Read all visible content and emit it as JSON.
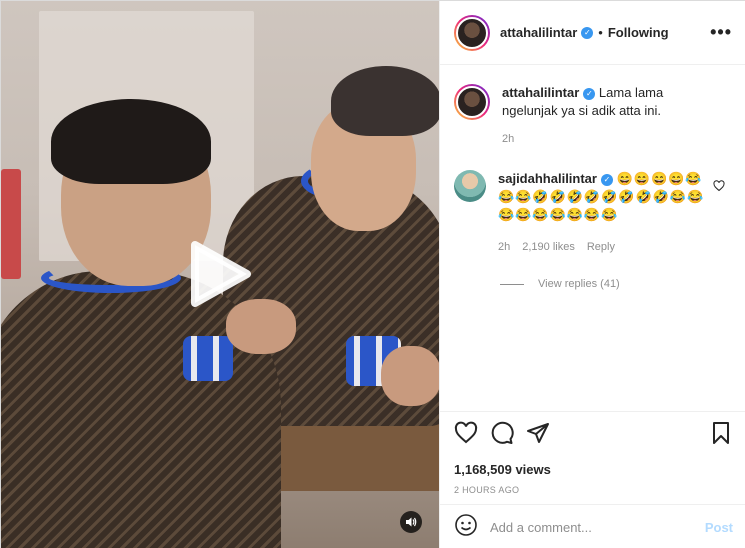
{
  "header": {
    "username": "attahalilintar",
    "separator": "•",
    "follow_status": "Following",
    "more_label": "•••"
  },
  "caption": {
    "username": "attahalilintar",
    "text": "Lama lama ngelunjak ya si adik atta ini.",
    "time": "2h"
  },
  "comment": {
    "username": "sajidahhalilintar",
    "text": "😄😄😄😄😂😂😂🤣🤣🤣🤣🤣🤣🤣🤣😂😂😂😂😂😂😂😂😂",
    "time": "2h",
    "likes": "2,190 likes",
    "reply_label": "Reply",
    "view_replies": "View replies (41)"
  },
  "post": {
    "views": "1,168,509 views",
    "posted_ago": "2 HOURS AGO"
  },
  "add_comment": {
    "placeholder": "Add a comment...",
    "post_label": "Post"
  },
  "icons": {
    "play": "play-icon",
    "volume": "volume-icon",
    "like": "heart-icon",
    "comment": "comment-icon",
    "share": "share-icon",
    "save": "bookmark-icon",
    "emoji": "emoji-icon"
  },
  "colors": {
    "verified": "#3897f0",
    "post_disabled": "#b3dbff",
    "secondary_text": "#8e8e8e"
  }
}
